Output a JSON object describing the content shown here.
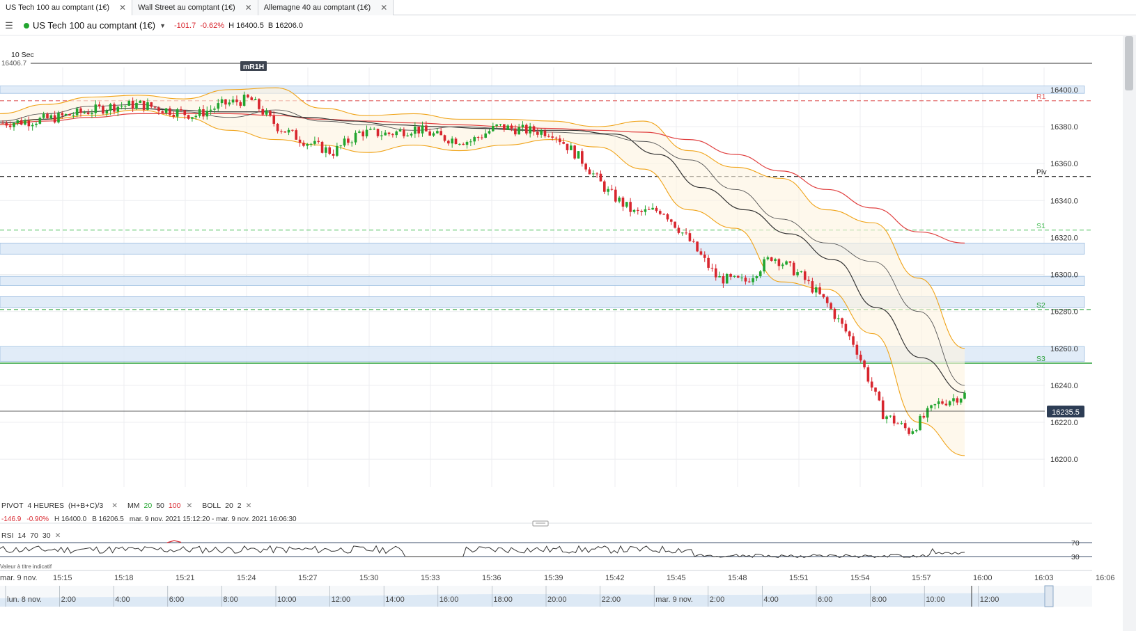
{
  "tabs": [
    {
      "label": "US Tech 100 au comptant (1€)",
      "close": "✕"
    },
    {
      "label": "Wall Street au comptant (1€)",
      "close": "✕"
    },
    {
      "label": "Allemagne 40 au comptant (1€)",
      "close": "✕"
    }
  ],
  "header": {
    "menu_icon": "hamburger-icon",
    "instrument": "US Tech 100 au comptant (1€)",
    "chevron": "▼",
    "change": "-101.7",
    "change_pct": "-0.62%",
    "high": "H 16400.5",
    "bid": "B 16206.0",
    "status_color": "#22a52f"
  },
  "colors": {
    "up": "#22a52f",
    "down": "#d8262e",
    "boll": "#f0a318",
    "ma20": "#f0a318",
    "ma50": "#333333",
    "ma100": "#e04040",
    "zone_fill": "#dce9f7",
    "zone_stroke": "#9bbde0"
  },
  "chart_data": {
    "type": "candlestick",
    "timeframe": "10 Sec",
    "current_price": 16235.5,
    "current_price_label": "16235.5",
    "top_line_label": "16406.7",
    "marker_label": "mR1H",
    "ylim": [
      16185,
      16412
    ],
    "y_ticks": [
      {
        "v": 16400,
        "label": "16400.0"
      },
      {
        "v": 16380,
        "label": "16380.0"
      },
      {
        "v": 16360,
        "label": "16360.0"
      },
      {
        "v": 16340,
        "label": "16340.0"
      },
      {
        "v": 16320,
        "label": "16320.0"
      },
      {
        "v": 16300,
        "label": "16300.0"
      },
      {
        "v": 16280,
        "label": "16280.0"
      },
      {
        "v": 16260,
        "label": "16260.0"
      },
      {
        "v": 16240,
        "label": "16240.0"
      },
      {
        "v": 16220,
        "label": "16220.0"
      },
      {
        "v": 16200,
        "label": "16200.0"
      }
    ],
    "x_ticks": [
      "mar. 9 nov.",
      "15:15",
      "15:18",
      "15:21",
      "15:24",
      "15:27",
      "15:30",
      "15:33",
      "15:36",
      "15:39",
      "15:42",
      "15:45",
      "15:48",
      "15:51",
      "15:54",
      "15:57",
      "16:00",
      "16:03",
      "16:06"
    ],
    "pivot_levels": [
      {
        "label": "R1",
        "value": 16394,
        "color": "#e06060",
        "style": "dash"
      },
      {
        "label": "Piv",
        "value": 16353,
        "color": "#222222",
        "style": "dash"
      },
      {
        "label": "S1",
        "value": 16324,
        "color": "#4cbf5a",
        "style": "dash"
      },
      {
        "label": "S2",
        "value": 16281,
        "color": "#2aa03a",
        "style": "dash"
      },
      {
        "label": "S3",
        "value": 16252,
        "color": "#2aa03a",
        "style": "solid"
      }
    ],
    "zones": [
      [
        16398,
        16402
      ],
      [
        16311,
        16317
      ],
      [
        16294,
        16299
      ],
      [
        16282,
        16288
      ],
      [
        16253,
        16261
      ]
    ],
    "series": [
      {
        "name": "ma20",
        "values": [
          16383,
          16387,
          16391,
          16392,
          16388,
          16385,
          16389,
          16383,
          16381,
          16378,
          16380,
          16379,
          16377,
          16376,
          16372,
          16362,
          16346,
          16330,
          16317,
          16307,
          16280,
          16240
        ]
      },
      {
        "name": "ma50",
        "values": [
          16382,
          16384,
          16388,
          16390,
          16389,
          16388,
          16388,
          16385,
          16383,
          16381,
          16380,
          16379,
          16378,
          16378,
          16376,
          16365,
          16347,
          16335,
          16322,
          16308,
          16282,
          16255,
          16236
        ]
      },
      {
        "name": "ma100",
        "values": [
          16381,
          16383,
          16385,
          16387,
          16387,
          16387,
          16386,
          16384,
          16383,
          16382,
          16381,
          16380,
          16379,
          16378,
          16377,
          16373,
          16365,
          16356,
          16346,
          16336,
          16323,
          16317
        ]
      },
      {
        "name": "boll_upper",
        "values": [
          16387,
          16392,
          16396,
          16397,
          16395,
          16400,
          16401,
          16390,
          16386,
          16387,
          16384,
          16384,
          16383,
          16380,
          16383,
          16367,
          16358,
          16352,
          16335,
          16328,
          16298,
          16260
        ]
      },
      {
        "name": "boll_lower",
        "values": [
          16381,
          16384,
          16386,
          16389,
          16385,
          16378,
          16373,
          16370,
          16366,
          16370,
          16367,
          16370,
          16373,
          16369,
          16357,
          16335,
          16325,
          16296,
          16292,
          16268,
          16220,
          16202
        ]
      }
    ],
    "close_path": [
      16382,
      16383,
      16385,
      16388,
      16391,
      16392,
      16389,
      16386,
      16392,
      16395,
      16380,
      16372,
      16366,
      16377,
      16376,
      16379,
      16374,
      16372,
      16380,
      16378,
      16377,
      16363,
      16345,
      16333,
      16335,
      16318,
      16298,
      16296,
      16310,
      16300,
      16284,
      16262,
      16225,
      16215,
      16230,
      16235
    ]
  },
  "indicators": {
    "pivot_label": "PIVOT",
    "pivot_period": "4 HEURES",
    "pivot_formula": "(H+B+C)/3",
    "mm_label": "MM",
    "mm_20": "20",
    "mm_50": "50",
    "mm_100": "100",
    "boll_label": "BOLL",
    "boll_period": "20",
    "boll_dev": "2",
    "remove": "✕"
  },
  "info": {
    "change": "-146.9",
    "change_pct": "-0.90%",
    "high": "H 16400.0",
    "bid": "B 16206.5",
    "range": "mar. 9 nov. 2021 15:12:20 - mar. 9 nov. 2021 16:06:30"
  },
  "rsi": {
    "label": "RSI",
    "period": "14",
    "upper": "70",
    "lower": "30",
    "upper_value": 70,
    "lower_value": 30,
    "remove": "✕",
    "disclaimer": "Valeur à titre indicatif",
    "upper_tick": "70",
    "lower_tick": "30"
  },
  "overview": {
    "labels": [
      "lun. 8 nov.",
      "2:00",
      "4:00",
      "6:00",
      "8:00",
      "10:00",
      "12:00",
      "14:00",
      "16:00",
      "18:00",
      "20:00",
      "22:00",
      "mar. 9 nov.",
      "2:00",
      "4:00",
      "6:00",
      "8:00",
      "10:00",
      "12:00"
    ]
  }
}
